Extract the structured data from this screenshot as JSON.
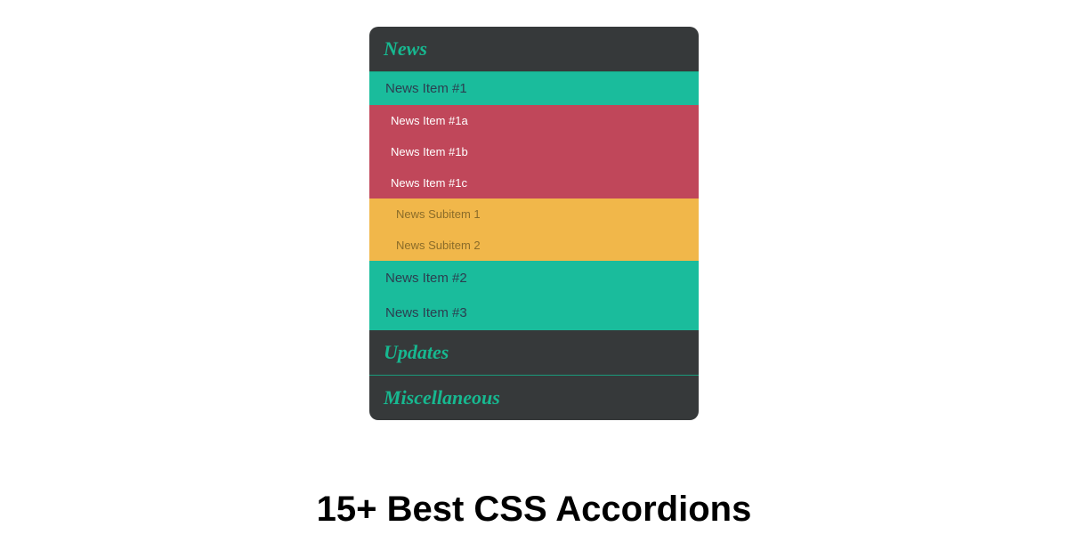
{
  "accordion": {
    "sections": [
      {
        "title": "News",
        "items": [
          {
            "label": "News Item #1"
          },
          {
            "label": "News Item #1a"
          },
          {
            "label": "News Item #1b"
          },
          {
            "label": "News Item #1c"
          },
          {
            "label": "News Subitem 1"
          },
          {
            "label": "News Subitem 2"
          },
          {
            "label": "News Item #2"
          },
          {
            "label": "News Item #3"
          }
        ]
      },
      {
        "title": "Updates"
      },
      {
        "title": "Miscellaneous"
      }
    ]
  },
  "page_title": "15+ Best CSS Accordions",
  "colors": {
    "header_bg": "#36393a",
    "header_text": "#17b890",
    "level1_bg": "#1abc9c",
    "level1_text": "#2c3e50",
    "level2_bg": "#c0475a",
    "level2_text": "#ffffff",
    "level3_bg": "#f1b74a",
    "level3_text": "#8b6c29"
  }
}
